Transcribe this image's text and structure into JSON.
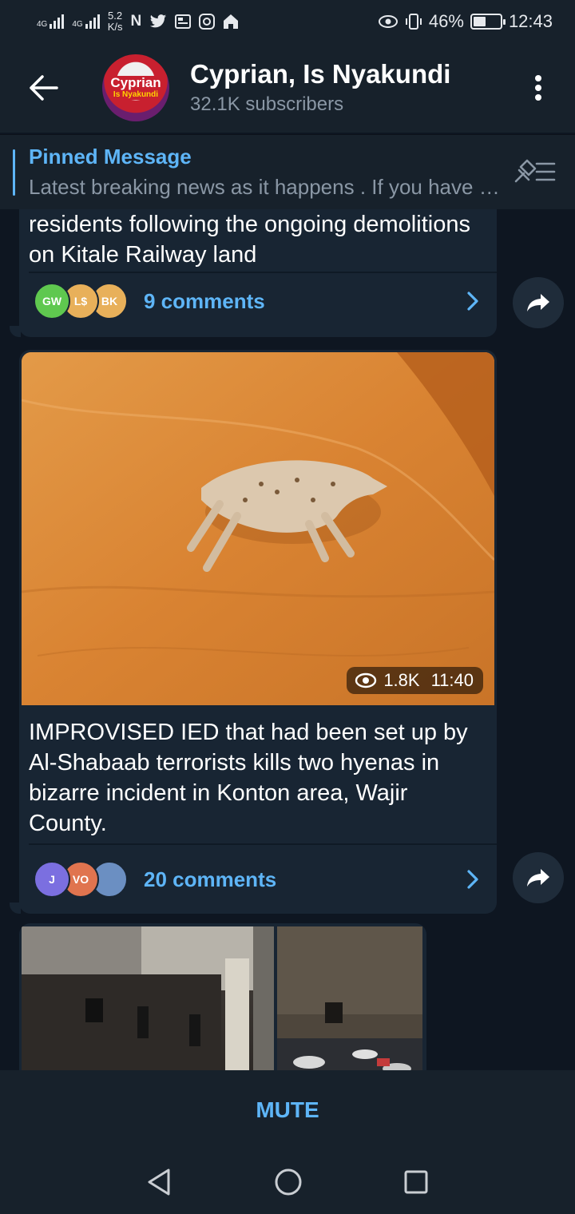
{
  "status_bar": {
    "net1": "4G",
    "net2": "4G",
    "speed_value": "5.2",
    "speed_unit": "K/s",
    "battery_text": "46%",
    "battery_level": 0.46,
    "time": "12:43",
    "icons": [
      "signal-icon",
      "netflix-icon",
      "twitter-icon",
      "newspaper-icon",
      "instagram-icon",
      "home-icon",
      "eye-icon",
      "vibrate-icon",
      "battery-icon"
    ]
  },
  "header": {
    "avatar_line1": "Cyprian",
    "avatar_line2": "Is Nyakundi",
    "title": "Cyprian, Is Nyakundi",
    "subtitle": "32.1K subscribers"
  },
  "pinned": {
    "title": "Pinned Message",
    "text": "Latest breaking news as it happens .  If you have any story you want us to publish"
  },
  "messages": [
    {
      "text": "residents following the ongoing demolitions on Kitale Railway land",
      "comment_avatars": [
        {
          "initials": "GW",
          "color": "#5fc84f"
        },
        {
          "initials": "L$",
          "color": "#e8b05a"
        },
        {
          "initials": "BK",
          "color": "#e8b05a"
        }
      ],
      "comments": "9 comments"
    },
    {
      "views": "1.8K",
      "time": "11:40",
      "text": "IMPROVISED IED that had been set up by Al-Shabaab terrorists kills two hyenas in bizarre incident in Konton area, Wajir County.",
      "comment_avatars": [
        {
          "initials": "J",
          "color": "#7b6fe0"
        },
        {
          "initials": "VO",
          "color": "#e0744f"
        },
        {
          "initials": "",
          "color": "#6b8fc2"
        }
      ],
      "comments": "20 comments"
    }
  ],
  "mute_label": "MUTE"
}
